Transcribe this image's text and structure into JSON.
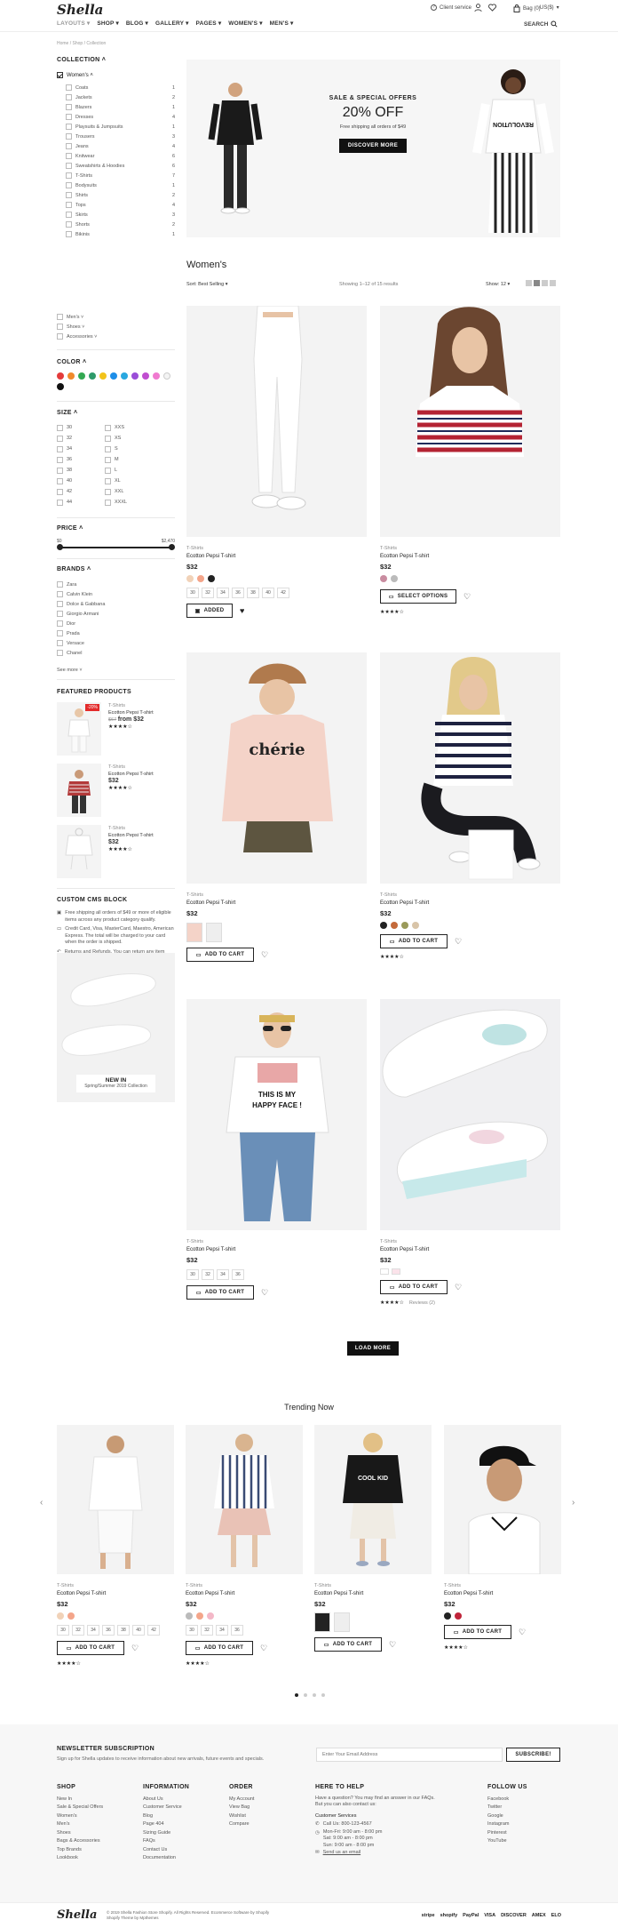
{
  "header": {
    "logo": "Shella",
    "client_service": "Client service",
    "bag": "Bag (0)",
    "currency": "US($)",
    "nav": [
      "LAYOUTS",
      "SHOP",
      "BLOG",
      "GALLERY",
      "PAGES",
      "WOMEN'S",
      "MEN'S"
    ],
    "search": "SEARCH",
    "breadcrumb": "Home / Shop / Collection"
  },
  "sidebar": {
    "collection_title": "COLLECTION",
    "womens": "Women's",
    "categories": [
      {
        "label": "Coats",
        "count": "1"
      },
      {
        "label": "Jackets",
        "count": "2"
      },
      {
        "label": "Blazers",
        "count": "1"
      },
      {
        "label": "Dresses",
        "count": "4"
      },
      {
        "label": "Playsuits & Jumpsuits",
        "count": "1"
      },
      {
        "label": "Trousers",
        "count": "3"
      },
      {
        "label": "Jeans",
        "count": "4"
      },
      {
        "label": "Knitwear",
        "count": "6"
      },
      {
        "label": "Sweatshirts & Hoodies",
        "count": "6"
      },
      {
        "label": "T-Shirts",
        "count": "7"
      },
      {
        "label": "Bodysuits",
        "count": "1"
      },
      {
        "label": "Shirts",
        "count": "2"
      },
      {
        "label": "Tops",
        "count": "4"
      },
      {
        "label": "Skirts",
        "count": "3"
      },
      {
        "label": "Shorts",
        "count": "2"
      },
      {
        "label": "Bikinis",
        "count": "1"
      }
    ],
    "other_collections": [
      "Men's",
      "Shoes",
      "Accessories"
    ],
    "color_title": "COLOR",
    "colors": [
      "#e43b3b",
      "#f08a2c",
      "#33a852",
      "#2e9a6a",
      "#f2c31a",
      "#1d8ee8",
      "#29a8e0",
      "#9a4ed8",
      "#c04ed0",
      "#f07ad0",
      "#f4f4f4",
      "#111111"
    ],
    "size_title": "SIZE",
    "sizes_left": [
      "30",
      "32",
      "34",
      "36",
      "38",
      "40",
      "42",
      "44"
    ],
    "sizes_right": [
      "XXS",
      "XS",
      "S",
      "M",
      "L",
      "XL",
      "XXL",
      "XXXL"
    ],
    "price_title": "PRICE",
    "price_min": "$0",
    "price_max": "$2,470",
    "price_range": [
      0,
      2470
    ],
    "brands_title": "BRANDS",
    "brands": [
      "Zara",
      "Calvin Klein",
      "Dolce & Gabbana",
      "Giorgio Armani",
      "Dior",
      "Prada",
      "Versace",
      "Chanel"
    ],
    "see_more": "See more",
    "featured_title": "FEATURED PRODUCTS",
    "featured": [
      {
        "cat": "T-Shirts",
        "name": "Ecotton Pepsi T-shirt",
        "old": "$67",
        "price": "from $32",
        "badge": "-20%"
      },
      {
        "cat": "T-Shirts",
        "name": "Ecotton Pepsi T-shirt",
        "price": "$32"
      },
      {
        "cat": "T-Shirts",
        "name": "Ecotton Pepsi T-shirt",
        "price": "$32"
      }
    ],
    "cms_title": "CUSTOM CMS BLOCK",
    "cms": [
      "Free shipping all orders of $49 or more of eligible items across any product category qualify.",
      "Credit Card, Visa, MasterCard, Maestro, American Express. The total will be charged to your card when the order is shipped.",
      "Returns and Refunds. You can return any item purchased on Shella within 20 days of the delivery date."
    ],
    "promo_title": "NEW IN",
    "promo_sub": "Spring/Summer 2019 Collection"
  },
  "banner": {
    "kicker": "SALE & SPECIAL OFFERS",
    "headline": "20% OFF",
    "sub": "Free shipping all orders of $49",
    "cta": "DISCOVER MORE",
    "tee_text": "REVOLUTION"
  },
  "listing": {
    "title": "Women's",
    "sort": "Sort: Best Selling",
    "showing": "Showing 1–12 of 15 results",
    "show": "Show: 12",
    "load_more": "LOAD MORE"
  },
  "products": [
    {
      "cat": "T-Shirts",
      "name": "Ecotton Pepsi T-shirt",
      "price": "$32",
      "sizes": [
        "30",
        "32",
        "34",
        "36",
        "38",
        "40",
        "42"
      ],
      "btn": "ADDED",
      "colors": [
        "#f1d2b8",
        "#f4a58a",
        "#222222"
      ]
    },
    {
      "cat": "T-Shirts",
      "name": "Ecotton Pepsi T-shirt",
      "price": "$32",
      "btn": "SELECT OPTIONS",
      "colors": [
        "#c98ca0",
        "#bbbbbb"
      ],
      "rating": 3.5
    },
    {
      "cat": "T-Shirts",
      "name": "Ecotton Pepsi T-shirt",
      "price": "$32",
      "btn": "ADD TO CART"
    },
    {
      "cat": "T-Shirts",
      "name": "Ecotton Pepsi T-shirt",
      "price": "$32",
      "btn": "ADD TO CART",
      "colors": [
        "#222222",
        "#c46a3b",
        "#9a9a5a",
        "#d8c4a8"
      ],
      "rating": 3.5
    },
    {
      "cat": "T-Shirts",
      "name": "Ecotton Pepsi T-shirt",
      "price": "$32",
      "sizes": [
        "30",
        "32",
        "34",
        "36"
      ],
      "btn": "ADD TO CART",
      "tee": "THIS IS MY HAPPY FACE !"
    },
    {
      "cat": "T-Shirts",
      "name": "Ecotton Pepsi T-shirt",
      "price": "$32",
      "btn": "ADD TO CART",
      "rating": 3.5,
      "reviews": "Reviews (2)"
    }
  ],
  "trending": {
    "title": "Trending Now",
    "items": [
      {
        "cat": "T-Shirts",
        "name": "Ecotton Pepsi T-shirt",
        "price": "$32",
        "sizes": [
          "30",
          "32",
          "34",
          "36",
          "38",
          "40",
          "42"
        ],
        "colors": [
          "#f1d2b8",
          "#f4a58a"
        ],
        "btn": "ADD TO CART",
        "rating": 3.5
      },
      {
        "cat": "T-Shirts",
        "name": "Ecotton Pepsi T-shirt",
        "price": "$32",
        "sizes": [
          "30",
          "32",
          "34",
          "36"
        ],
        "colors": [
          "#bbbbbb",
          "#f4a58a",
          "#f4b8c8"
        ],
        "btn": "ADD TO CART",
        "rating": 3.5
      },
      {
        "cat": "T-Shirts",
        "name": "Ecotton Pepsi T-shirt",
        "price": "$32",
        "btn": "ADD TO CART",
        "tee": "COOL KID"
      },
      {
        "cat": "T-Shirts",
        "name": "Ecotton Pepsi T-shirt",
        "price": "$32",
        "colors": [
          "#222222",
          "#c0243a"
        ],
        "btn": "ADD TO CART",
        "rating": 3.5
      }
    ]
  },
  "footer": {
    "newsletter_title": "NEWSLETTER SUBSCRIPTION",
    "newsletter_text": "Sign up for Shella updates to receive information about new arrivals, future events and specials.",
    "email_placeholder": "Enter Your Email Address",
    "subscribe": "SUBSCRIBE!",
    "shop_title": "SHOP",
    "shop": [
      "New In",
      "Sale & Special Offers",
      "Women's",
      "Men's",
      "Shoes",
      "Bags & Accessories",
      "Top Brands",
      "Lookbook"
    ],
    "info_title": "INFORMATION",
    "info": [
      "About Us",
      "Customer Service",
      "Blog",
      "Page 404",
      "Sizing Guide",
      "FAQs",
      "Contact Us",
      "Documentation"
    ],
    "order_title": "ORDER",
    "order": [
      "My Account",
      "View Bag",
      "Wishlist",
      "Compare"
    ],
    "help_title": "HERE TO HELP",
    "help_text": "Have a question? You may find an answer in our FAQs. But you can also contact us:",
    "customer_services": "Customer Services",
    "phone": "Call Us: 800-123-4567",
    "hours": [
      "Mon-Fri: 9:00 am - 8:00 pm",
      "Sat: 9:00 am - 8:00 pm",
      "Sun: 9:00 am - 8:00 pm"
    ],
    "email": "Send us an email",
    "follow_title": "FOLLOW US",
    "follow": [
      "Facebook",
      "Twitter",
      "Google",
      "Instagram",
      "Pinterest",
      "YouTube"
    ],
    "copyright": "© 2019 Shella Fashion Store Shopify. All Rights Reserved. Ecommerce Software by Shopify",
    "credit": "Shopify Theme by Mpthemes",
    "payments": [
      "stripe",
      "shopify",
      "PayPal",
      "VISA",
      "DISCOVER",
      "AMEX",
      "ELO"
    ]
  }
}
